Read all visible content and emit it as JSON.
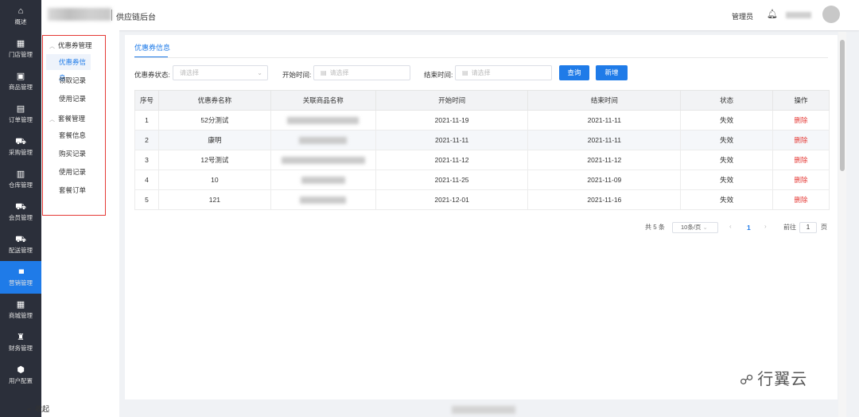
{
  "rail": {
    "items": [
      {
        "label": "概述",
        "icon": "⌂"
      },
      {
        "label": "门店管理",
        "icon": "▦"
      },
      {
        "label": "商品管理",
        "icon": "▣"
      },
      {
        "label": "订单管理",
        "icon": "▤"
      },
      {
        "label": "采购管理",
        "icon": "⛟"
      },
      {
        "label": "仓库管理",
        "icon": "▥"
      },
      {
        "label": "会员管理",
        "icon": "⛟"
      },
      {
        "label": "配送管理",
        "icon": "⛟"
      },
      {
        "label": "营销管理",
        "icon": "▮▮▮"
      },
      {
        "label": "商城管理",
        "icon": "▦"
      },
      {
        "label": "财务管理",
        "icon": "♜"
      },
      {
        "label": "用户配置",
        "icon": "⬢"
      }
    ]
  },
  "header": {
    "title": "供应链后台",
    "admin": "管理员"
  },
  "subnav": {
    "group1": "优惠券管理",
    "group1_items": [
      "优惠券信息",
      "领取记录",
      "使用记录"
    ],
    "group2": "套餐管理",
    "group2_items": [
      "套餐信息",
      "购买记录",
      "使用记录",
      "套餐订单"
    ],
    "collapse": "收起"
  },
  "main": {
    "tab": "优惠券信息",
    "filters": {
      "status_label": "优惠券状态:",
      "status_placeholder": "请选择",
      "start_label": "开始时间:",
      "start_placeholder": "请选择",
      "end_label": "结束时间:",
      "end_placeholder": "请选择",
      "query": "查询",
      "add": "新增"
    },
    "table": {
      "headers": [
        "序号",
        "优惠券名称",
        "关联商品名称",
        "开始时间",
        "结束时间",
        "状态",
        "操作"
      ],
      "rows": [
        {
          "no": "1",
          "name": "52分测试",
          "start": "2021-11-19",
          "end": "2021-11-11",
          "status": "失效",
          "op": "删除"
        },
        {
          "no": "2",
          "name": "康明",
          "start": "2021-11-11",
          "end": "2021-11-11",
          "status": "失效",
          "op": "删除"
        },
        {
          "no": "3",
          "name": "12号测试",
          "start": "2021-11-12",
          "end": "2021-11-12",
          "status": "失效",
          "op": "删除"
        },
        {
          "no": "4",
          "name": "10",
          "start": "2021-11-25",
          "end": "2021-11-09",
          "status": "失效",
          "op": "删除"
        },
        {
          "no": "5",
          "name": "121",
          "start": "2021-12-01",
          "end": "2021-11-16",
          "status": "失效",
          "op": "删除"
        }
      ]
    },
    "pager": {
      "total": "共 5 条",
      "page_size": "10条/页",
      "page": "1",
      "goto": "前往",
      "goto_value": "1",
      "unit": "页",
      "prev": "‹",
      "next": "›"
    }
  },
  "watermark": "行翼云"
}
